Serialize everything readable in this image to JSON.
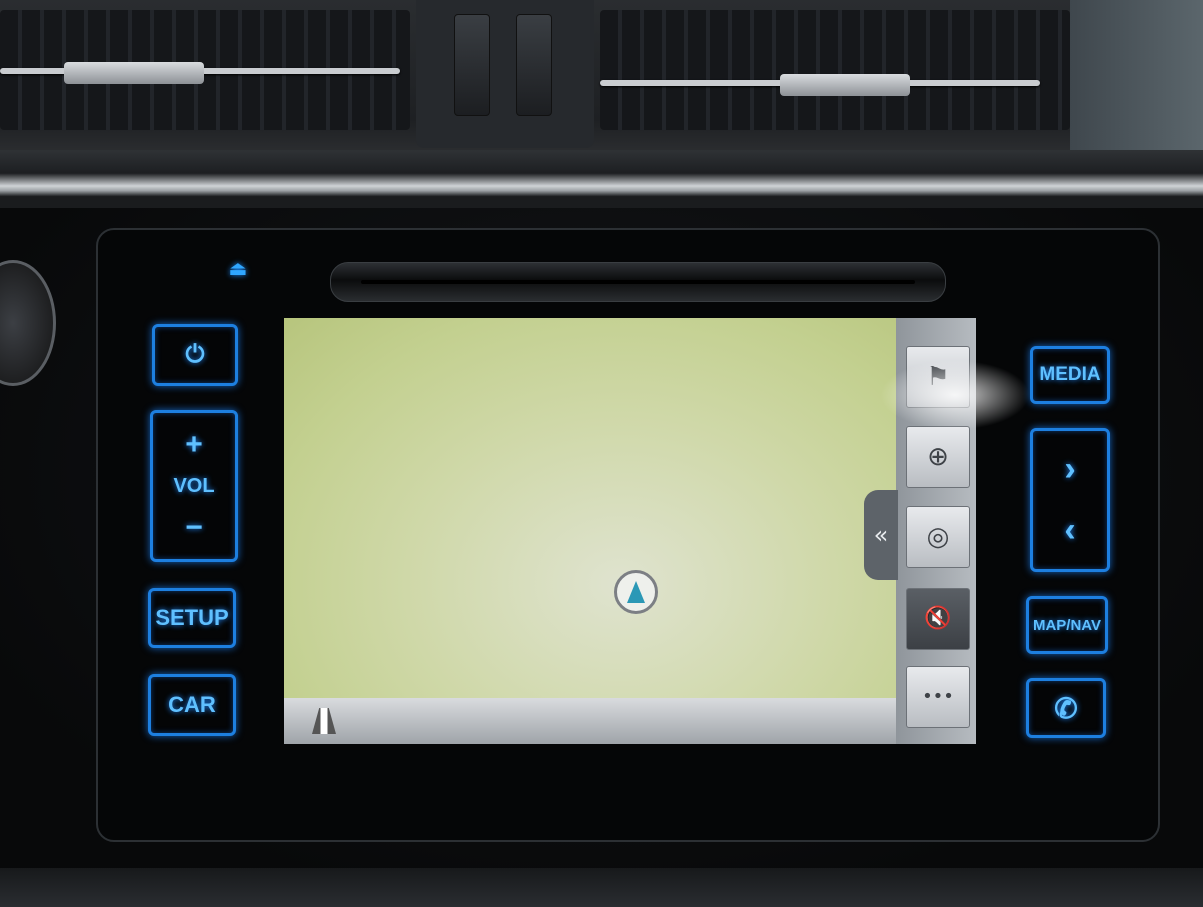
{
  "head_unit": {
    "buttons_left": {
      "power_label": "⏻",
      "vol_plus": "+",
      "vol_label": "VOL",
      "vol_minus": "−",
      "setup_label": "SETUP",
      "car_label": "CAR"
    },
    "buttons_right": {
      "media_label": "MEDIA",
      "next_label": "›",
      "prev_label": "‹",
      "map_nav_label": "MAP/NAV",
      "phone_icon": "phone-icon"
    },
    "eject_icon": "eject-icon"
  },
  "screen": {
    "side_buttons": [
      {
        "icon": "destination-flag-icon",
        "glyph": "⚑"
      },
      {
        "icon": "zoom-in-icon",
        "glyph": "⊕"
      },
      {
        "icon": "current-position-icon",
        "glyph": "◎"
      },
      {
        "icon": "mute-icon",
        "glyph": "🔇"
      },
      {
        "icon": "more-options-icon",
        "glyph": "•••"
      }
    ],
    "collapse_glyph": "«"
  }
}
